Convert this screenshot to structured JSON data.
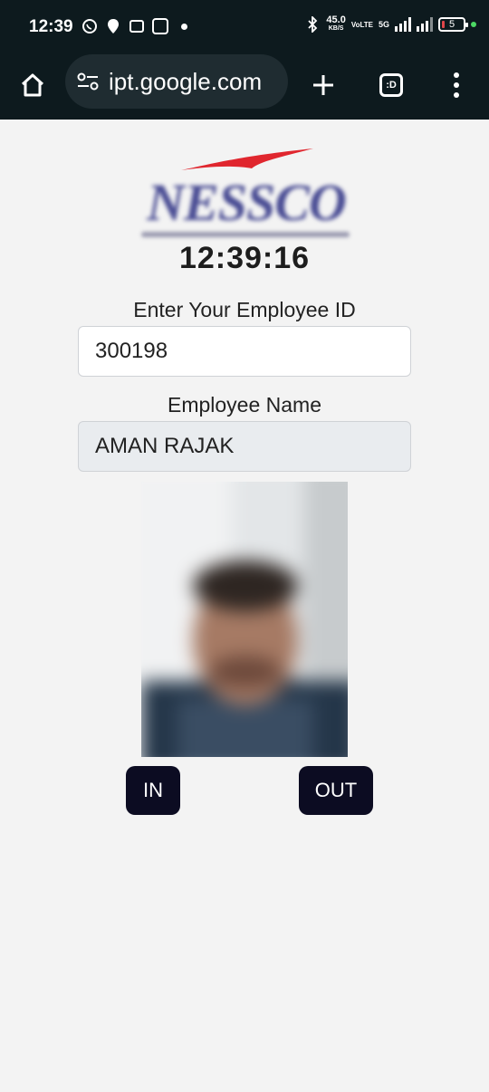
{
  "status_bar": {
    "time": "12:39",
    "net_speed": "45.0",
    "net_unit": "KB/S",
    "network_tag": "VoLTE",
    "network_type": "5G",
    "battery": "5"
  },
  "browser": {
    "url": "ipt.google.com",
    "tabs_label": ":D"
  },
  "page": {
    "logo_text": "NESSCO",
    "clock": "12:39:16",
    "employee_id_label": "Enter Your Employee ID",
    "employee_id_value": "300198",
    "employee_name_label": "Employee Name",
    "employee_name_value": "AMAN RAJAK",
    "in_button": "IN",
    "out_button": "OUT"
  },
  "colors": {
    "status_bg": "#0d1a1e",
    "page_bg": "#f3f3f3",
    "button_bg": "#0c0c22",
    "logo_blue": "#4a4d94",
    "logo_red": "#e0262e"
  }
}
